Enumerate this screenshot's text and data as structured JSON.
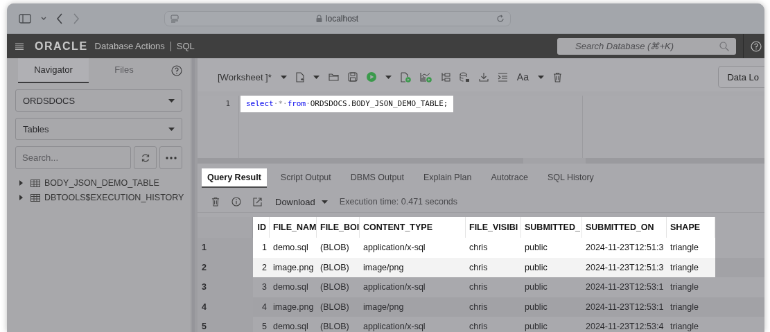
{
  "browser": {
    "url": "localhost"
  },
  "app_bar": {
    "brand": "ORACLE",
    "product": "Database Actions",
    "section": "SQL",
    "search_placeholder": "Search Database (⌘+K)"
  },
  "sidebar": {
    "tabs": [
      {
        "label": "Navigator",
        "selected": true
      },
      {
        "label": "Files",
        "selected": false
      }
    ],
    "schema": "ORDSDOCS",
    "object_type": "Tables",
    "search_placeholder": "Search...",
    "tree": [
      {
        "label": "BODY_JSON_DEMO_TABLE",
        "expanded": false
      },
      {
        "label": "DBTOOLS$EXECUTION_HISTORY",
        "expanded": false
      }
    ]
  },
  "worksheet": {
    "title": "[Worksheet ]*",
    "text_size": "Aa",
    "data_button": "Data Lo",
    "lines": [
      {
        "number": "1",
        "highlighted": true,
        "tokens": [
          {
            "text": "select",
            "kind": "keyword"
          },
          {
            "text": "·",
            "kind": "space"
          },
          {
            "text": "*",
            "kind": "operator"
          },
          {
            "text": "·",
            "kind": "space"
          },
          {
            "text": "from",
            "kind": "keyword"
          },
          {
            "text": "·",
            "kind": "space"
          },
          {
            "text": "ORDSDOCS.BODY_JSON_DEMO_TABLE;",
            "kind": "plain"
          }
        ]
      }
    ]
  },
  "results": {
    "tabs": [
      {
        "label": "Query Result",
        "selected": true,
        "highlighted": true
      },
      {
        "label": "Script Output",
        "selected": false,
        "highlighted": false
      },
      {
        "label": "DBMS Output",
        "selected": false,
        "highlighted": false
      },
      {
        "label": "Explain Plan",
        "selected": false,
        "highlighted": false
      },
      {
        "label": "Autotrace",
        "selected": false,
        "highlighted": false
      },
      {
        "label": "SQL History",
        "selected": false,
        "highlighted": false
      }
    ],
    "download": "Download",
    "execution_time": "Execution time: 0.471 seconds",
    "table": {
      "header_highlighted": true,
      "columns": [
        "ID",
        "FILE_NAM",
        "FILE_BOI",
        "CONTENT_TYPE",
        "FILE_VISIBI",
        "SUBMITTED_",
        "SUBMITTED_ON",
        "SHAPE"
      ],
      "rows": [
        {
          "number": "1",
          "highlighted": true,
          "cells": [
            "1",
            "demo.sql",
            "(BLOB)",
            "application/x-sql",
            "chris",
            "public",
            "2024-11-23T12:51:3",
            "triangle"
          ]
        },
        {
          "number": "2",
          "highlighted": true,
          "cells": [
            "2",
            "image.png",
            "(BLOB)",
            "image/png",
            "chris",
            "public",
            "2024-11-23T12:51:3",
            "triangle"
          ]
        },
        {
          "number": "3",
          "highlighted": false,
          "cells": [
            "3",
            "demo.sql",
            "(BLOB)",
            "application/x-sql",
            "chris",
            "public",
            "2024-11-23T12:53:1",
            "triangle"
          ]
        },
        {
          "number": "4",
          "highlighted": false,
          "cells": [
            "4",
            "image.png",
            "(BLOB)",
            "image/png",
            "chris",
            "public",
            "2024-11-23T12:53:1",
            "triangle"
          ]
        },
        {
          "number": "5",
          "highlighted": false,
          "cells": [
            "5",
            "demo.sql",
            "(BLOB)",
            "application/x-sql",
            "chris",
            "public",
            "2024-11-23T12:53:4",
            "triangle"
          ]
        }
      ]
    }
  }
}
